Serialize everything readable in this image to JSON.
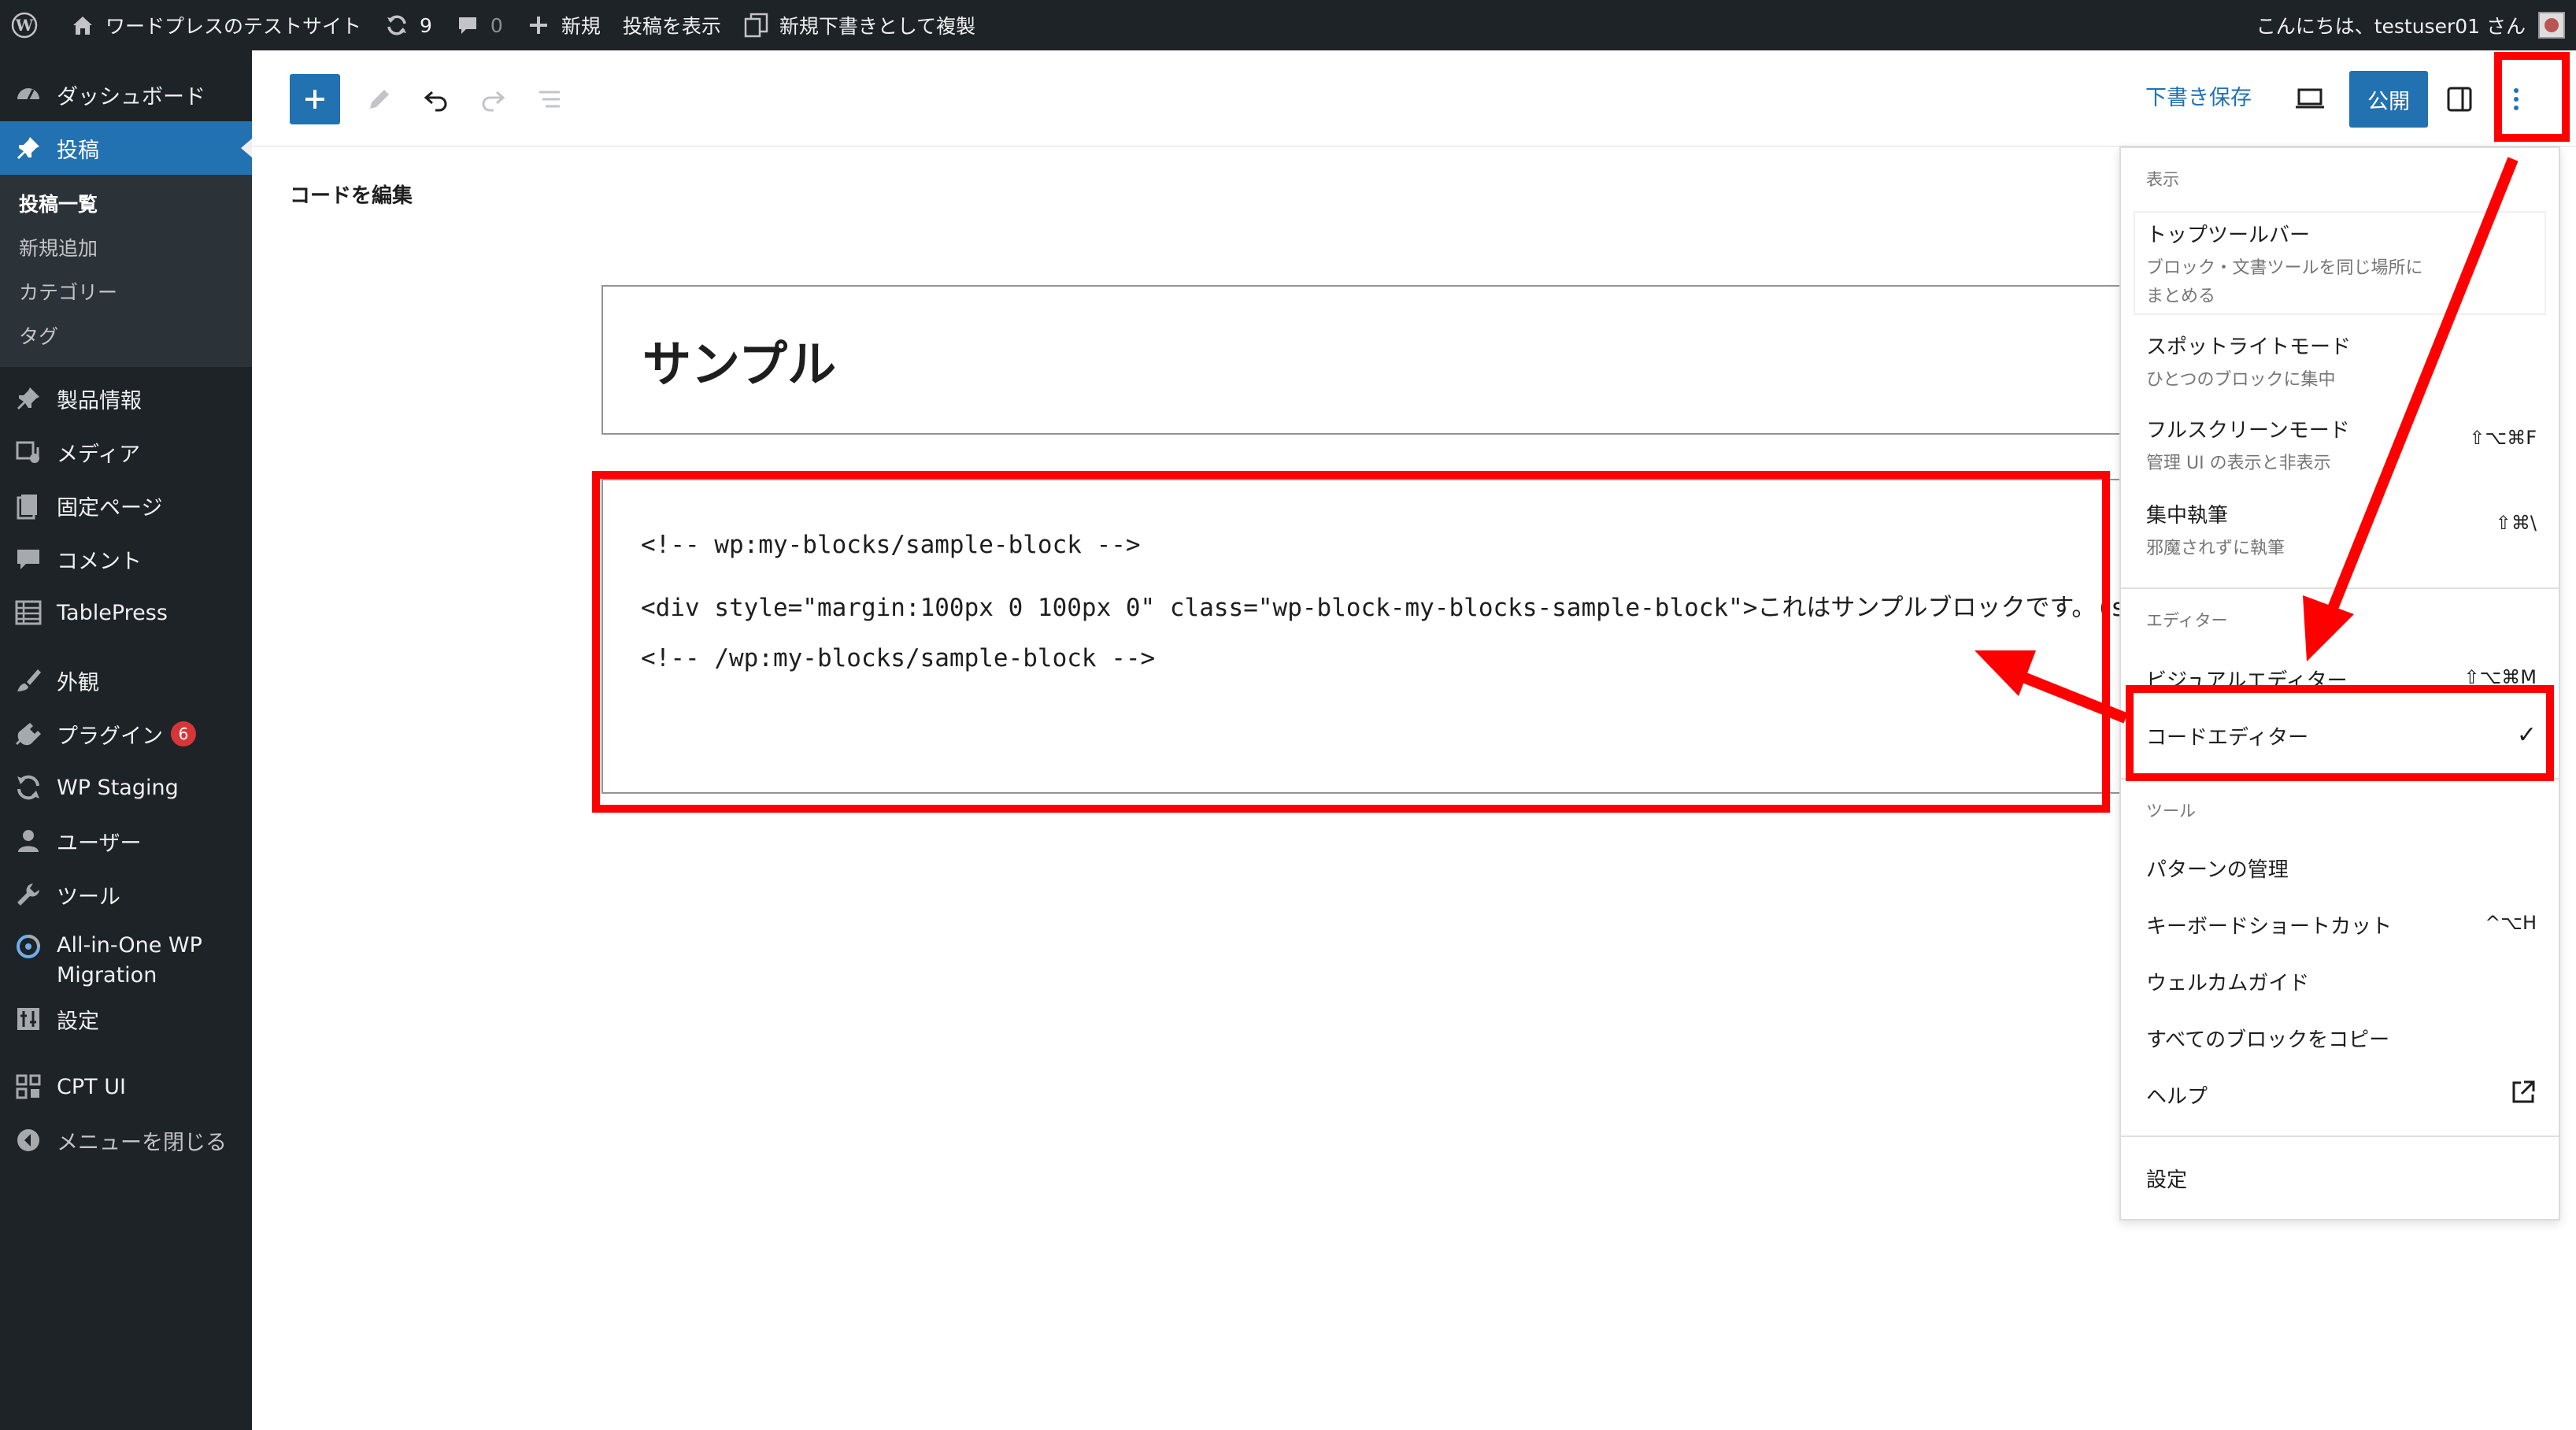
{
  "adminbar": {
    "site_name": "ワードプレスのテストサイト",
    "updates_count": "9",
    "comments_count": "0",
    "new_label": "新規",
    "view_post": "投稿を表示",
    "duplicate_draft": "新規下書きとして複製",
    "greeting": "こんにちは、testuser01 さん"
  },
  "sidebar": {
    "dashboard": "ダッシュボード",
    "posts": "投稿",
    "posts_sub": [
      "投稿一覧",
      "新規追加",
      "カテゴリー",
      "タグ"
    ],
    "product_info": "製品情報",
    "media": "メディア",
    "pages": "固定ページ",
    "comments": "コメント",
    "tablepress": "TablePress",
    "appearance": "外観",
    "plugins": "プラグイン",
    "plugins_badge": "6",
    "wp_staging": "WP Staging",
    "users": "ユーザー",
    "tools": "ツール",
    "aio_line1": "All-in-One WP",
    "aio_line2": "Migration",
    "settings": "設定",
    "cpt_ui": "CPT UI",
    "collapse": "メニューを閉じる"
  },
  "toolbar": {
    "save_draft": "下書き保存",
    "publish": "公開"
  },
  "editor": {
    "heading": "コードを編集",
    "post_title": "サンプル",
    "code_lines": [
      "<!-- wp:my-blocks/sample-block -->",
      "<div style=\"margin:100px 0 100px 0\" class=\"wp-block-my-blocks-sample-block\">これはサンプルブロックです。(save)</",
      "<!-- /wp:my-blocks/sample-block -->"
    ]
  },
  "menu": {
    "view_label": "表示",
    "top_toolbar": "トップツールバー",
    "top_toolbar_desc1": "ブロック・文書ツールを同じ場所に",
    "top_toolbar_desc2": "まとめる",
    "spotlight": "スポットライトモード",
    "spotlight_desc": "ひとつのブロックに集中",
    "fullscreen": "フルスクリーンモード",
    "fullscreen_desc": "管理 UI の表示と非表示",
    "fullscreen_shortcut": "⇧⌥⌘F",
    "distraction_free": "集中執筆",
    "distraction_free_desc": "邪魔されずに執筆",
    "distraction_free_shortcut": "⇧⌘\\",
    "editor_label": "エディター",
    "visual_editor": "ビジュアルエディター",
    "visual_editor_shortcut": "⇧⌥⌘M",
    "code_editor": "コードエディター",
    "code_editor_check": "✓",
    "tools_label": "ツール",
    "manage_patterns": "パターンの管理",
    "keyboard_shortcuts": "キーボードショートカット",
    "keyboard_shortcuts_key": "^⌥H",
    "welcome_guide": "ウェルカムガイド",
    "copy_all_blocks": "すべてのブロックをコピー",
    "help": "ヘルプ",
    "preferences": "設定"
  },
  "colors": {
    "admin_dark": "#1d2327",
    "accent_blue": "#2271b1",
    "annotation_red": "#ff0000",
    "badge_red": "#d63638"
  }
}
